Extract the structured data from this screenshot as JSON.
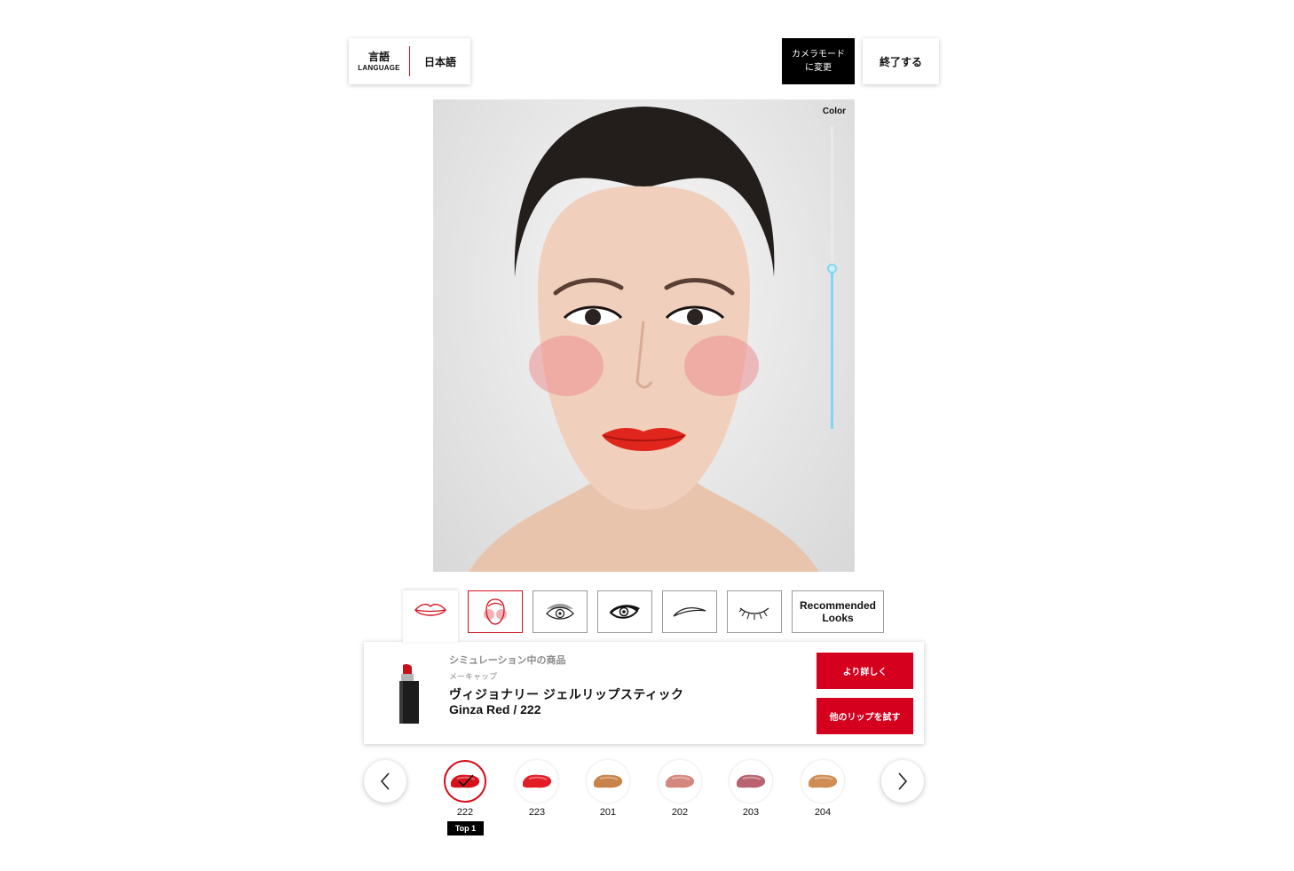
{
  "header": {
    "language_label": "言語",
    "language_sub": "LANGUAGE",
    "language_value": "日本語",
    "camera_button": "カメラモード\nに変更",
    "exit_button": "終了する"
  },
  "viewer": {
    "color_label": "Color",
    "color_intensity_percent": 53
  },
  "category_tabs": [
    {
      "icon": "lips-icon",
      "active": true
    },
    {
      "icon": "blush-face-icon",
      "active": false
    },
    {
      "icon": "eyeshadow-icon",
      "active": false
    },
    {
      "icon": "eyeliner-icon",
      "active": false
    },
    {
      "icon": "eyebrow-icon",
      "active": false
    },
    {
      "icon": "eyelash-icon",
      "active": false
    },
    {
      "label": "Recommended\nLooks",
      "active": false
    }
  ],
  "product": {
    "subtitle": "シミュレーション中の商品",
    "category": "メーキャップ",
    "name": "ヴィジョナリー ジェルリップスティック",
    "shade": "Ginza Red / 222",
    "more_button": "より詳しく",
    "try_other_button": "他のリップを試す"
  },
  "shades": [
    {
      "code": "222",
      "color": "#d8101a",
      "selected": true,
      "badge": "Top 1"
    },
    {
      "code": "223",
      "color": "#e31d28",
      "selected": false
    },
    {
      "code": "201",
      "color": "#c9824a",
      "selected": false
    },
    {
      "code": "202",
      "color": "#d4877f",
      "selected": false
    },
    {
      "code": "203",
      "color": "#b8636f",
      "selected": false
    },
    {
      "code": "204",
      "color": "#cf8d55",
      "selected": false
    }
  ],
  "colors": {
    "accent_red": "#d4001e",
    "slider_blue": "#7fd7f7"
  }
}
